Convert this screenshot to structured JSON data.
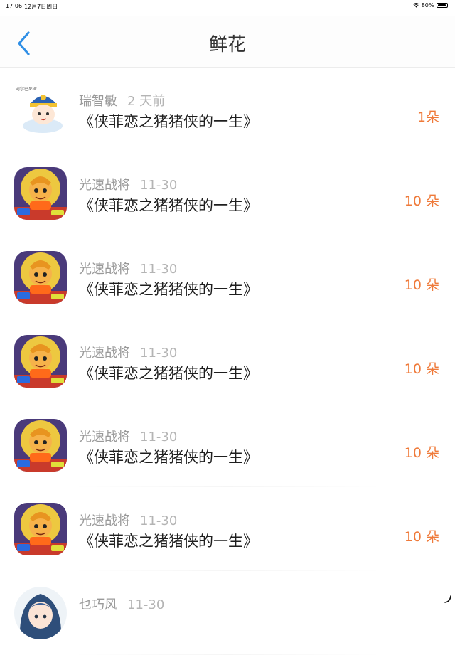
{
  "status_bar": {
    "time": "17:06",
    "date": "12月7日周日",
    "battery": "80%"
  },
  "header": {
    "title": "鲜花"
  },
  "items": [
    {
      "name": "瑞智敏",
      "time": "2 天前",
      "title": "《侠菲恋之猪猪侠的一生》",
      "count": "1朵",
      "avatar": "sticker-avatar"
    },
    {
      "name": "光速战将",
      "time": "11-30",
      "title": "《侠菲恋之猪猪侠的一生》",
      "count": "10 朵",
      "avatar": "hero-avatar"
    },
    {
      "name": "光速战将",
      "time": "11-30",
      "title": "《侠菲恋之猪猪侠的一生》",
      "count": "10 朵",
      "avatar": "hero-avatar"
    },
    {
      "name": "光速战将",
      "time": "11-30",
      "title": "《侠菲恋之猪猪侠的一生》",
      "count": "10 朵",
      "avatar": "hero-avatar"
    },
    {
      "name": "光速战将",
      "time": "11-30",
      "title": "《侠菲恋之猪猪侠的一生》",
      "count": "10 朵",
      "avatar": "hero-avatar"
    },
    {
      "name": "光速战将",
      "time": "11-30",
      "title": "《侠菲恋之猪猪侠的一生》",
      "count": "10 朵",
      "avatar": "hero-avatar"
    },
    {
      "name": "乜巧风",
      "time": "11-30",
      "title": "",
      "count": "",
      "avatar": "girl-avatar"
    }
  ],
  "colors": {
    "accent": "#2f8fe6",
    "count": "#ef7a3a"
  }
}
